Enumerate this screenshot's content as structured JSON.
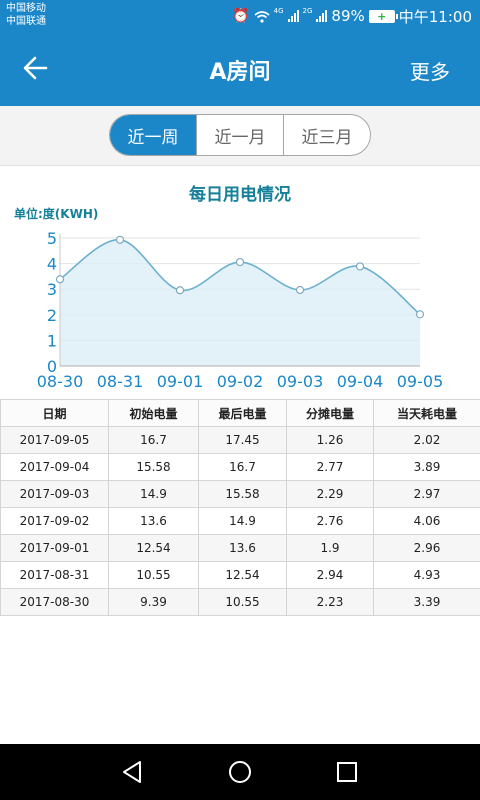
{
  "status_bar": {
    "carrier_1": "中国移动",
    "carrier_2": "中国联通",
    "net_1": "4G",
    "net_2": "2G",
    "battery": "89%",
    "time": "中午11:00"
  },
  "header": {
    "title": "A房间",
    "more_label": "更多",
    "back_icon": "arrow-left-icon"
  },
  "tabs": [
    {
      "label": "近一周",
      "active": true
    },
    {
      "label": "近一月",
      "active": false
    },
    {
      "label": "近三月",
      "active": false
    }
  ],
  "chart_data": {
    "type": "area",
    "title": "每日用电情况",
    "ylabel": "单位:度(KWH)",
    "xlabel": "",
    "categories": [
      "08-30",
      "08-31",
      "09-01",
      "09-02",
      "09-03",
      "09-04",
      "09-05"
    ],
    "series": [
      {
        "values": [
          3.39,
          4.93,
          2.96,
          4.06,
          2.97,
          3.89,
          2.02
        ]
      }
    ],
    "yticks": [
      0,
      1,
      2,
      3,
      4,
      5
    ],
    "ylim": [
      0,
      5
    ],
    "grid": true,
    "colors": {
      "line": "#6bb0d0",
      "fill": "#d9eef6",
      "text": "#1b87c9",
      "title": "#16809a"
    }
  },
  "table": {
    "headers": [
      "日期",
      "初始电量",
      "最后电量",
      "分摊电量",
      "当天耗电量"
    ],
    "rows": [
      [
        "2017-09-05",
        "16.7",
        "17.45",
        "1.26",
        "2.02"
      ],
      [
        "2017-09-04",
        "15.58",
        "16.7",
        "2.77",
        "3.89"
      ],
      [
        "2017-09-03",
        "14.9",
        "15.58",
        "2.29",
        "2.97"
      ],
      [
        "2017-09-02",
        "13.6",
        "14.9",
        "2.76",
        "4.06"
      ],
      [
        "2017-09-01",
        "12.54",
        "13.6",
        "1.9",
        "2.96"
      ],
      [
        "2017-08-31",
        "10.55",
        "12.54",
        "2.94",
        "4.93"
      ],
      [
        "2017-08-30",
        "9.39",
        "10.55",
        "2.23",
        "3.39"
      ]
    ]
  },
  "nav_bar": {
    "back_icon": "triangle-back-icon",
    "home_icon": "circle-home-icon",
    "recents_icon": "square-recents-icon"
  }
}
